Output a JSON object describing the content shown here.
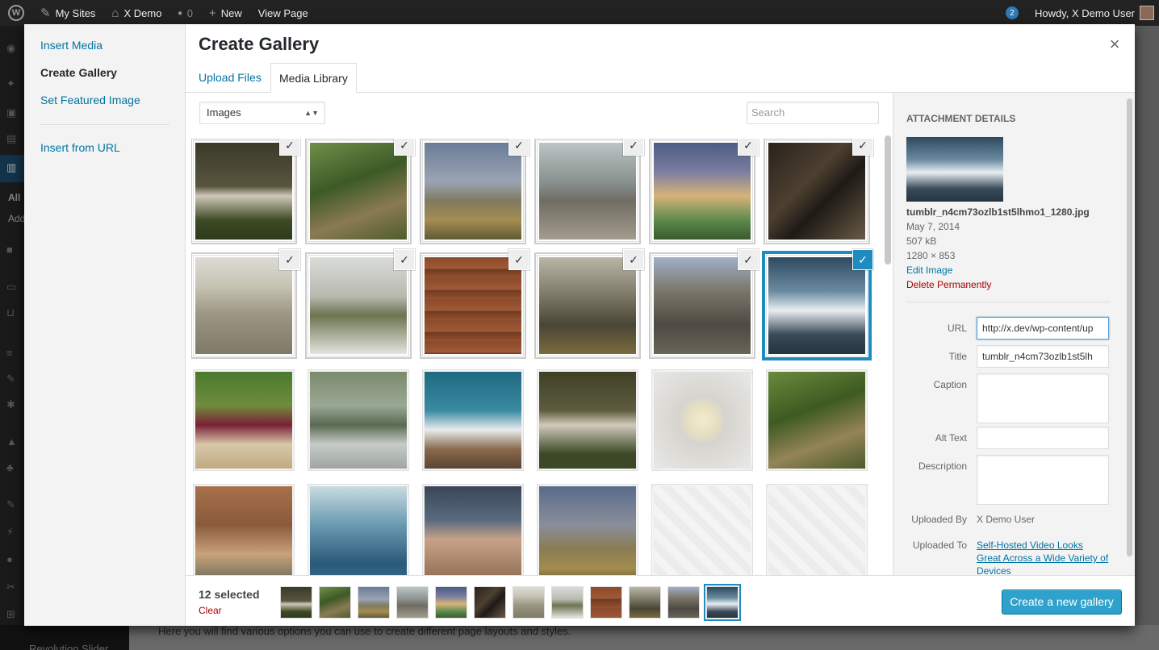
{
  "adminbar": {
    "items": [
      "My Sites",
      "X Demo",
      "0",
      "New",
      "View Page"
    ],
    "notifications": "2",
    "greeting": "Howdy, X Demo User"
  },
  "background": {
    "side_text_all": "All",
    "side_text_add": "Add",
    "bottom_text": "Here you will find various options you can use to create different page layouts and styles.",
    "bottom_side_text": "Revolution Slider"
  },
  "menu": {
    "items": [
      {
        "label": "Insert Media"
      },
      {
        "label": "Create Gallery"
      },
      {
        "label": "Set Featured Image"
      },
      {
        "label": "Insert from URL"
      }
    ]
  },
  "modal": {
    "title": "Create Gallery",
    "close_glyph": "×"
  },
  "tabs": [
    {
      "label": "Upload Files"
    },
    {
      "label": "Media Library"
    }
  ],
  "toolbar": {
    "filter_value": "Images",
    "filter_arrow": "▲▼",
    "search_placeholder": "Search"
  },
  "check_glyph": "✓",
  "attachments": [
    {
      "palette": "t0"
    },
    {
      "palette": "t1"
    },
    {
      "palette": "t2"
    },
    {
      "palette": "t3"
    },
    {
      "palette": "t4"
    },
    {
      "palette": "t5"
    },
    {
      "palette": "t6"
    },
    {
      "palette": "t7"
    },
    {
      "palette": "t8"
    },
    {
      "palette": "t9"
    },
    {
      "palette": "t10"
    },
    {
      "palette": "t11"
    },
    {
      "palette": "t12"
    },
    {
      "palette": "t13"
    },
    {
      "palette": "t14"
    },
    {
      "palette": "t15"
    },
    {
      "palette": "t16"
    },
    {
      "palette": "t17"
    },
    {
      "palette": "t18"
    },
    {
      "palette": "t19"
    },
    {
      "palette": "t20"
    },
    {
      "palette": "t21"
    },
    {
      "palette": "t22"
    },
    {
      "palette": "t23"
    }
  ],
  "details": {
    "heading": "Attachment Details",
    "filename": "tumblr_n4cm73ozlb1st5lhmo1_1280.jpg",
    "date": "May 7, 2014",
    "size": "507 kB",
    "dimensions": "1280 × 853",
    "edit_label": "Edit Image",
    "delete_label": "Delete Permanently",
    "url_label": "URL",
    "url_value": "http://x.dev/wp-content/up",
    "title_label": "Title",
    "title_value": "tumblr_n4cm73ozlb1st5lh",
    "caption_label": "Caption",
    "alt_label": "Alt Text",
    "description_label": "Description",
    "uploaded_by_label": "Uploaded By",
    "uploaded_by_value": "X Demo User",
    "uploaded_to_label": "Uploaded To",
    "uploaded_to_value": "Self-Hosted Video Looks Great Across a Wide Variety of Devices"
  },
  "selection": {
    "count_label": "12 selected",
    "clear_label": "Clear"
  },
  "primary_button": "Create a new gallery"
}
